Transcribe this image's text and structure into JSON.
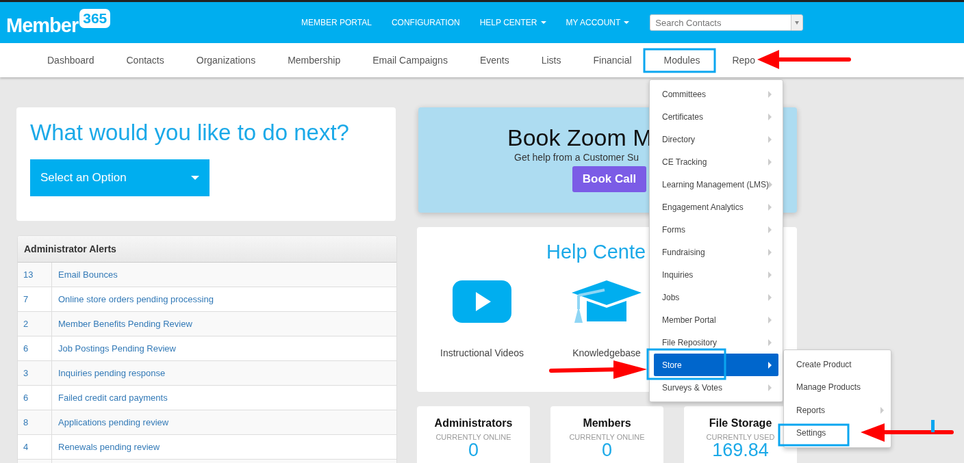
{
  "header": {
    "logo": {
      "word": "Member",
      "badge": "365"
    },
    "links": [
      {
        "label": "MEMBER PORTAL",
        "dropdown": false
      },
      {
        "label": "CONFIGURATION",
        "dropdown": false
      },
      {
        "label": "HELP CENTER",
        "dropdown": true
      },
      {
        "label": "MY ACCOUNT",
        "dropdown": true
      }
    ],
    "search": {
      "placeholder": "Search Contacts"
    }
  },
  "nav": [
    "Dashboard",
    "Contacts",
    "Organizations",
    "Membership",
    "Email Campaigns",
    "Events",
    "Lists",
    "Financial",
    "Modules",
    "Repo"
  ],
  "next_card": {
    "title": "What would you like to do next?",
    "select": "Select an Option"
  },
  "alerts": {
    "title": "Administrator Alerts",
    "rows": [
      {
        "count": "13",
        "label": "Email Bounces"
      },
      {
        "count": "7",
        "label": "Online store orders pending processing"
      },
      {
        "count": "2",
        "label": "Member Benefits Pending Review"
      },
      {
        "count": "6",
        "label": "Job Postings Pending Review"
      },
      {
        "count": "3",
        "label": "Inquiries pending response"
      },
      {
        "count": "6",
        "label": "Failed credit card payments"
      },
      {
        "count": "8",
        "label": "Applications pending review"
      },
      {
        "count": "4",
        "label": "Renewals pending review"
      }
    ]
  },
  "book_card": {
    "title": "Book Zoom M",
    "subtitle": "Get help from a Customer Su",
    "button": "Book Call"
  },
  "help_card": {
    "title": "Help Cente",
    "items": [
      {
        "kind": "video",
        "label": "Instructional Videos"
      },
      {
        "kind": "cap",
        "label": "Knowledgebase"
      }
    ]
  },
  "stats": [
    {
      "title": "Administrators",
      "caption": "CURRENTLY ONLINE",
      "value": "0"
    },
    {
      "title": "Members",
      "caption": "CURRENTLY ONLINE",
      "value": "0"
    },
    {
      "title": "File Storage",
      "caption": "CURRENTLY USED",
      "value": "169.84"
    }
  ],
  "modules_menu": {
    "items": [
      {
        "label": "Committees",
        "selected": false,
        "submenu": true
      },
      {
        "label": "Certificates",
        "selected": false,
        "submenu": true
      },
      {
        "label": "Directory",
        "selected": false,
        "submenu": true
      },
      {
        "label": "CE Tracking",
        "selected": false,
        "submenu": true
      },
      {
        "label": "Learning Management (LMS)",
        "selected": false,
        "submenu": true
      },
      {
        "label": "Engagement Analytics",
        "selected": false,
        "submenu": true
      },
      {
        "label": "Forms",
        "selected": false,
        "submenu": true
      },
      {
        "label": "Fundraising",
        "selected": false,
        "submenu": true
      },
      {
        "label": "Inquiries",
        "selected": false,
        "submenu": true
      },
      {
        "label": "Jobs",
        "selected": false,
        "submenu": true
      },
      {
        "label": "Member Portal",
        "selected": false,
        "submenu": true
      },
      {
        "label": "File Repository",
        "selected": false,
        "submenu": true
      },
      {
        "label": "Store",
        "selected": true,
        "submenu": true
      },
      {
        "label": "Surveys & Votes",
        "selected": false,
        "submenu": true
      }
    ]
  },
  "store_menu": {
    "items": [
      {
        "label": "Create Product",
        "selected": false,
        "submenu": false
      },
      {
        "label": "Manage Products",
        "selected": false,
        "submenu": false
      },
      {
        "label": "Reports",
        "selected": false,
        "submenu": true
      },
      {
        "label": "Settings",
        "selected": false
      }
    ]
  }
}
